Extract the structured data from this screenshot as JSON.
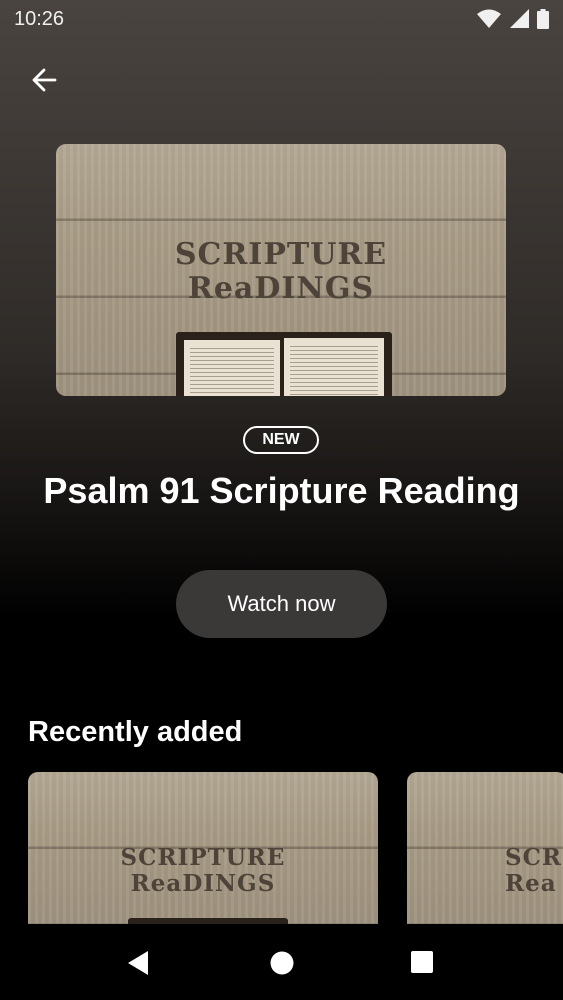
{
  "status_bar": {
    "time": "10:26",
    "icons": [
      "wifi-icon",
      "signal-icon",
      "battery-icon"
    ]
  },
  "header": {
    "back_icon": "arrow-left-icon"
  },
  "hero": {
    "image_title_line1": "SCRIPTURE",
    "image_title_line2": "ReaDINGS",
    "badge": "NEW",
    "title": "Psalm 91 Scripture Reading",
    "cta": "Watch now"
  },
  "recently_added": {
    "title": "Recently added",
    "items": [
      {
        "line1": "SCRIPTURE",
        "line2": "ReaDINGS"
      },
      {
        "line1": "SCR",
        "line2": "Rea"
      }
    ]
  },
  "nav": {
    "icons": [
      "back-triangle-icon",
      "home-circle-icon",
      "recents-square-icon"
    ]
  },
  "colors": {
    "background": "#000000",
    "button": "#3a3938",
    "card_wood": "#a89c86",
    "art_text": "#4d4338"
  }
}
